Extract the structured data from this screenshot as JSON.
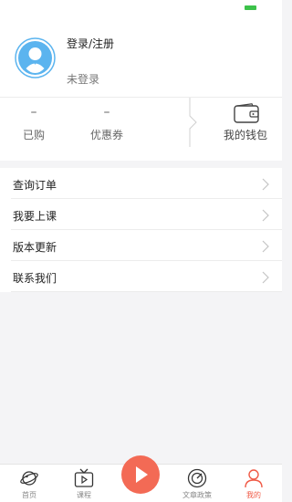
{
  "colors": {
    "accent": "#f36a55",
    "avatar": "#5bb4ef",
    "status_green": "#3cc24a"
  },
  "profile": {
    "title": "登录/注册",
    "status": "未登录"
  },
  "stats": {
    "bought": {
      "value": "–",
      "label": "已购"
    },
    "coupons": {
      "value": "–",
      "label": "优惠券"
    },
    "wallet_label": "我的钱包"
  },
  "menu": {
    "items": [
      {
        "label": "查询订单"
      },
      {
        "label": "我要上课"
      },
      {
        "label": "版本更新"
      },
      {
        "label": "联系我们"
      }
    ]
  },
  "tabbar": {
    "home": "首页",
    "course": "课程",
    "articles": "文章政策",
    "mine": "我的"
  }
}
